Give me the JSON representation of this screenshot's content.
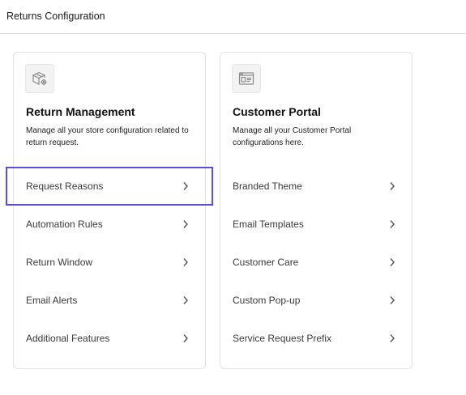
{
  "header": {
    "title": "Returns Configuration"
  },
  "cards": [
    {
      "title": "Return Management",
      "description": "Manage all your store configuration related to return request.",
      "icon": "box-gear-icon",
      "items": [
        {
          "label": "Request Reasons",
          "selected": true
        },
        {
          "label": "Automation Rules",
          "selected": false
        },
        {
          "label": "Return Window",
          "selected": false
        },
        {
          "label": "Email Alerts",
          "selected": false
        },
        {
          "label": "Additional Features",
          "selected": false
        }
      ]
    },
    {
      "title": "Customer Portal",
      "description": "Manage all your Customer Portal configurations here.",
      "icon": "portal-window-icon",
      "items": [
        {
          "label": "Branded Theme",
          "selected": false
        },
        {
          "label": "Email Templates",
          "selected": false
        },
        {
          "label": "Customer Care",
          "selected": false
        },
        {
          "label": "Custom Pop-up",
          "selected": false
        },
        {
          "label": "Service Request Prefix",
          "selected": false
        }
      ]
    }
  ],
  "colors": {
    "selection_outline": "#5a4fd9",
    "border": "#e3e3e3"
  }
}
